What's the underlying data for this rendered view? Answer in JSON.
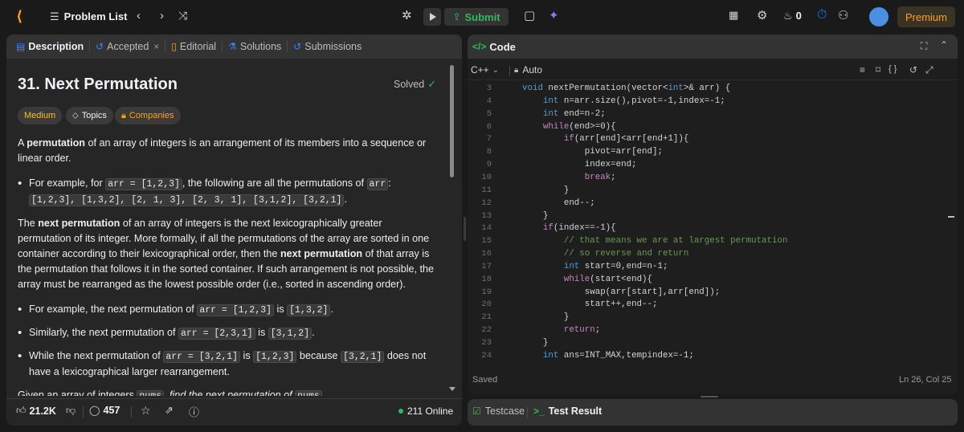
{
  "nav": {
    "problem_list": "Problem List",
    "submit": "Submit",
    "streak_count": "0",
    "premium": "Premium"
  },
  "left_tabs": {
    "description": "Description",
    "accepted": "Accepted",
    "editorial": "Editorial",
    "solutions": "Solutions",
    "submissions": "Submissions"
  },
  "problem": {
    "title": "31. Next Permutation",
    "status": "Solved",
    "difficulty": "Medium",
    "topics": "Topics",
    "companies": "Companies",
    "p1_pre": "A ",
    "p1_bold": "permutation",
    "p1_post": " of an array of integers is an arrangement of its members into a sequence or linear order.",
    "b1_pre": "For example, for ",
    "b1_code1": "arr = [1,2,3]",
    "b1_mid": ", the following are all the permutations of ",
    "b1_code2": "arr",
    "b1_colon": ": ",
    "b1_code3": "[1,2,3], [1,3,2], [2, 1, 3], [2, 3, 1], [3,1,2], [3,2,1]",
    "b1_end": ".",
    "p2_pre": "The ",
    "p2_bold1": "next permutation",
    "p2_mid1": " of an array of integers is the next lexicographically greater permutation of its integer. More formally, if all the permutations of the array are sorted in one container according to their lexicographical order, then the ",
    "p2_bold2": "next permutation",
    "p2_post": " of that array is the permutation that follows it in the sorted container. If such arrangement is not possible, the array must be rearranged as the lowest possible order (i.e., sorted in ascending order).",
    "b2_pre": "For example, the next permutation of ",
    "b2_code1": "arr = [1,2,3]",
    "b2_mid": " is ",
    "b2_code2": "[1,3,2]",
    "b2_end": ".",
    "b3_pre": "Similarly, the next permutation of ",
    "b3_code1": "arr = [2,3,1]",
    "b3_mid": " is ",
    "b3_code2": "[3,1,2]",
    "b3_end": ".",
    "b4_pre": "While the next permutation of ",
    "b4_code1": "arr = [3,2,1]",
    "b4_mid": " is ",
    "b4_code2": "[1,2,3]",
    "b4_mid2": " because ",
    "b4_code3": "[3,2,1]",
    "b4_post": " does not have a lexicographical larger rearrangement.",
    "cut_pre": "Given an array of integers ",
    "cut_code": "nums",
    "cut_mid": ", find the next permutation of ",
    "cut_code2": "nums"
  },
  "footer_left": {
    "likes": "21.2K",
    "comments": "457",
    "online": "211 Online"
  },
  "code_panel": {
    "title": "Code",
    "language": "C++",
    "mode": "Auto",
    "saved": "Saved",
    "cursor": "Ln 26, Col 25"
  },
  "code": {
    "line_numbers": [
      "3",
      "4",
      "5",
      "6",
      "7",
      "8",
      "9",
      "10",
      "11",
      "12",
      "13",
      "14",
      "15",
      "16",
      "17",
      "18",
      "19",
      "20",
      "21",
      "22",
      "23",
      "24"
    ],
    "lines": [
      "void nextPermutation(vector<int>& arr) {",
      "    int n=arr.size(),pivot=-1,index=-1;",
      "    int end=n-2;",
      "    while(end>=0){",
      "        if(arr[end]<arr[end+1]){",
      "            pivot=arr[end];",
      "            index=end;",
      "            break;",
      "        }",
      "        end--;",
      "    }",
      "    if(index==-1){",
      "        // that means we are at largest permutation",
      "        // so reverse and return",
      "        int start=0,end=n-1;",
      "        while(start<end){",
      "            swap(arr[start],arr[end]);",
      "            start++,end--;",
      "        }",
      "        return;",
      "    }",
      "    int ans=INT_MAX,tempindex=-1;"
    ]
  },
  "bottom_tabs": {
    "testcase": "Testcase",
    "test_result": "Test Result"
  },
  "colors": {
    "accent_green": "#2cbb5d",
    "medium_yellow": "#ffc01e",
    "premium_orange": "#ffa116",
    "code_keyword": "#569cd6",
    "code_control": "#c586c0",
    "code_comment": "#6a9955"
  }
}
